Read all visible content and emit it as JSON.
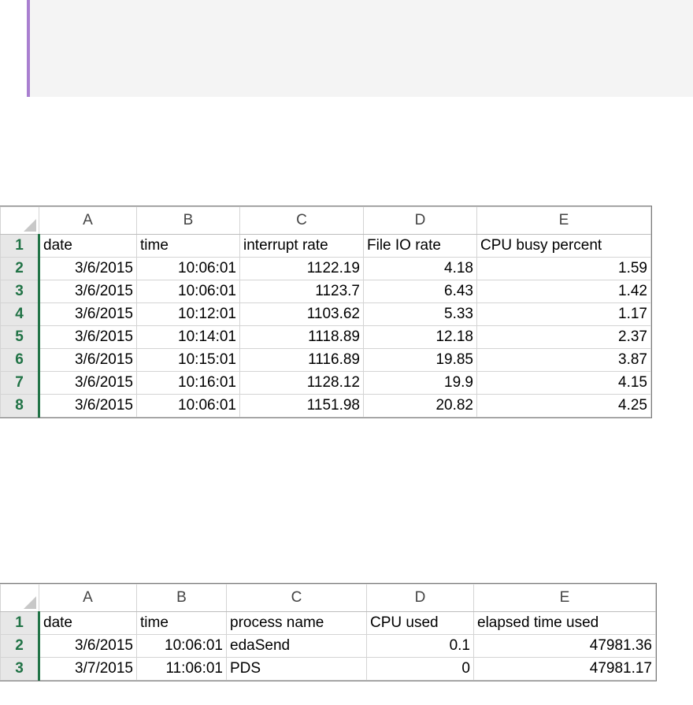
{
  "sheet1": {
    "columns": [
      "A",
      "B",
      "C",
      "D",
      "E"
    ],
    "rows": [
      {
        "num": "1",
        "cells": [
          "date",
          "time",
          "interrupt rate",
          "File IO rate",
          "CPU busy percent"
        ]
      },
      {
        "num": "2",
        "cells": [
          "3/6/2015",
          "10:06:01",
          "1122.19",
          "4.18",
          "1.59"
        ]
      },
      {
        "num": "3",
        "cells": [
          "3/6/2015",
          "10:06:01",
          "1123.7",
          "6.43",
          "1.42"
        ]
      },
      {
        "num": "4",
        "cells": [
          "3/6/2015",
          "10:12:01",
          "1103.62",
          "5.33",
          "1.17"
        ]
      },
      {
        "num": "5",
        "cells": [
          "3/6/2015",
          "10:14:01",
          "1118.89",
          "12.18",
          "2.37"
        ]
      },
      {
        "num": "6",
        "cells": [
          "3/6/2015",
          "10:15:01",
          "1116.89",
          "19.85",
          "3.87"
        ]
      },
      {
        "num": "7",
        "cells": [
          "3/6/2015",
          "10:16:01",
          "1128.12",
          "19.9",
          "4.15"
        ]
      },
      {
        "num": "8",
        "cells": [
          "3/6/2015",
          "10:06:01",
          "1151.98",
          "20.82",
          "4.25"
        ]
      }
    ]
  },
  "sheet2": {
    "columns": [
      "A",
      "B",
      "C",
      "D",
      "E"
    ],
    "rows": [
      {
        "num": "1",
        "cells": [
          "date",
          "time",
          "process name",
          "CPU used",
          "elapsed time used"
        ]
      },
      {
        "num": "2",
        "cells": [
          "3/6/2015",
          "10:06:01",
          "edaSend",
          "0.1",
          "47981.36"
        ]
      },
      {
        "num": "3",
        "cells": [
          "3/7/2015",
          "11:06:01",
          "PDS",
          "0",
          "47981.17"
        ]
      }
    ]
  },
  "colors": {
    "row_header_accent": "#217346",
    "callout_border": "#a97fd0"
  }
}
